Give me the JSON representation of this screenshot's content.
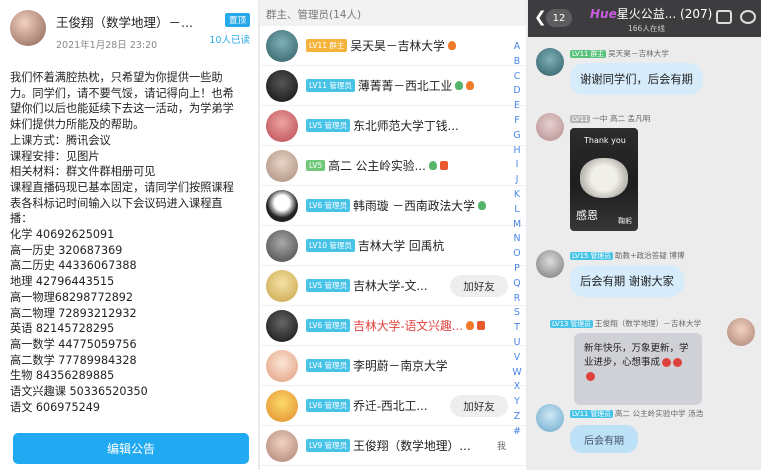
{
  "announcement": {
    "author": "王俊翔（数学地理）－...",
    "date": "2021年1月28日 23:20",
    "pin_label": "置顶",
    "read_count": "10人已读",
    "lines": [
      "我们怀着满腔热枕，只希望为你提供一些助",
      "力。同学们，请不要气馁，请记得向上！也希",
      "望你们以后也能延续下去这一活动，为学弟学",
      "妹们提供力所能及的帮助。",
      "上课方式：腾讯会议",
      "课程安排：见图片",
      "相关材料：群文件群相册可见",
      "课程直播码现已基本固定，请同学们按照课程",
      "表各科标记时间输入以下会议码进入课程直",
      "播：",
      "化学 40692625091",
      "高一历史 320687369",
      "高二历史 44336067388",
      "地理 42796443515",
      "高一物理68298772892",
      "高二物理 72893212932",
      "英语 82145728295",
      "高一数学 44775059756",
      "高二数学 77789984328",
      "生物 84356289885",
      "语文兴趣课 50336520350",
      "语文 606975249"
    ],
    "edit_button": "编辑公告"
  },
  "members": {
    "header": "群主、管理员(14人)",
    "add_friend_label": "加好友",
    "me_label": "我",
    "items": [
      {
        "badge": "LV11 群主",
        "name": "吴天昊－吉林大学",
        "red": false
      },
      {
        "badge": "LV11 管理员",
        "name": "薄菁菁－西北工业",
        "red": false
      },
      {
        "badge": "LV5 管理员",
        "name": "东北师范大学丁钱...",
        "red": false
      },
      {
        "badge": "LV5",
        "name": "高二  公主岭实验...",
        "red": false
      },
      {
        "badge": "LV6 管理员",
        "name": "韩雨璇 －西南政法大学",
        "red": false
      },
      {
        "badge": "LV10 管理员",
        "name": "吉林大学 回禹杭",
        "red": false
      },
      {
        "badge": "LV5 管理员",
        "name": "吉林大学-文...",
        "red": false
      },
      {
        "badge": "LV6 管理员",
        "name": "吉林大学-语文兴趣...",
        "red": true
      },
      {
        "badge": "LV4 管理员",
        "name": "李明蔚－南京大学",
        "red": false
      },
      {
        "badge": "LV6 管理员",
        "name": "乔迁-西北工...",
        "red": false
      },
      {
        "badge": "LV9 管理员",
        "name": "王俊翔（数学地理）...",
        "red": false
      }
    ],
    "alphabet": [
      "A",
      "B",
      "C",
      "D",
      "E",
      "F",
      "G",
      "H",
      "I",
      "J",
      "K",
      "L",
      "M",
      "N",
      "O",
      "P",
      "Q",
      "R",
      "S",
      "T",
      "U",
      "V",
      "W",
      "X",
      "Y",
      "Z",
      "#"
    ]
  },
  "chat": {
    "unread": "12",
    "title": "星火公益...",
    "logo": "Hue",
    "count": "(207)",
    "online": "166人在线",
    "messages": [
      {
        "sender_tag": "LV11 群主",
        "sender": "吴天昊－吉林大学",
        "text": "谢谢同学们，后会有期"
      },
      {
        "sender_tag": "LV11",
        "sender": "一中 高二 孟凡明",
        "img_top": "Thank you",
        "img_main": "感恩",
        "img_small": "鞠躬"
      },
      {
        "sender_tag": "LV15 管理员",
        "sender": "助教+政治答疑 博博",
        "text": "后会有期 谢谢大家"
      },
      {
        "sender_tag": "LV13 管理员",
        "sender": "王俊翔（数学地理）－吉林大学",
        "card_line1": "新年快乐，万象更新，学",
        "card_line2": "业进步，心想事成"
      },
      {
        "sender_tag": "LV11 管理员",
        "sender": "高二  公主岭实验中学 汤浩",
        "sticker": "后会有期"
      }
    ]
  }
}
